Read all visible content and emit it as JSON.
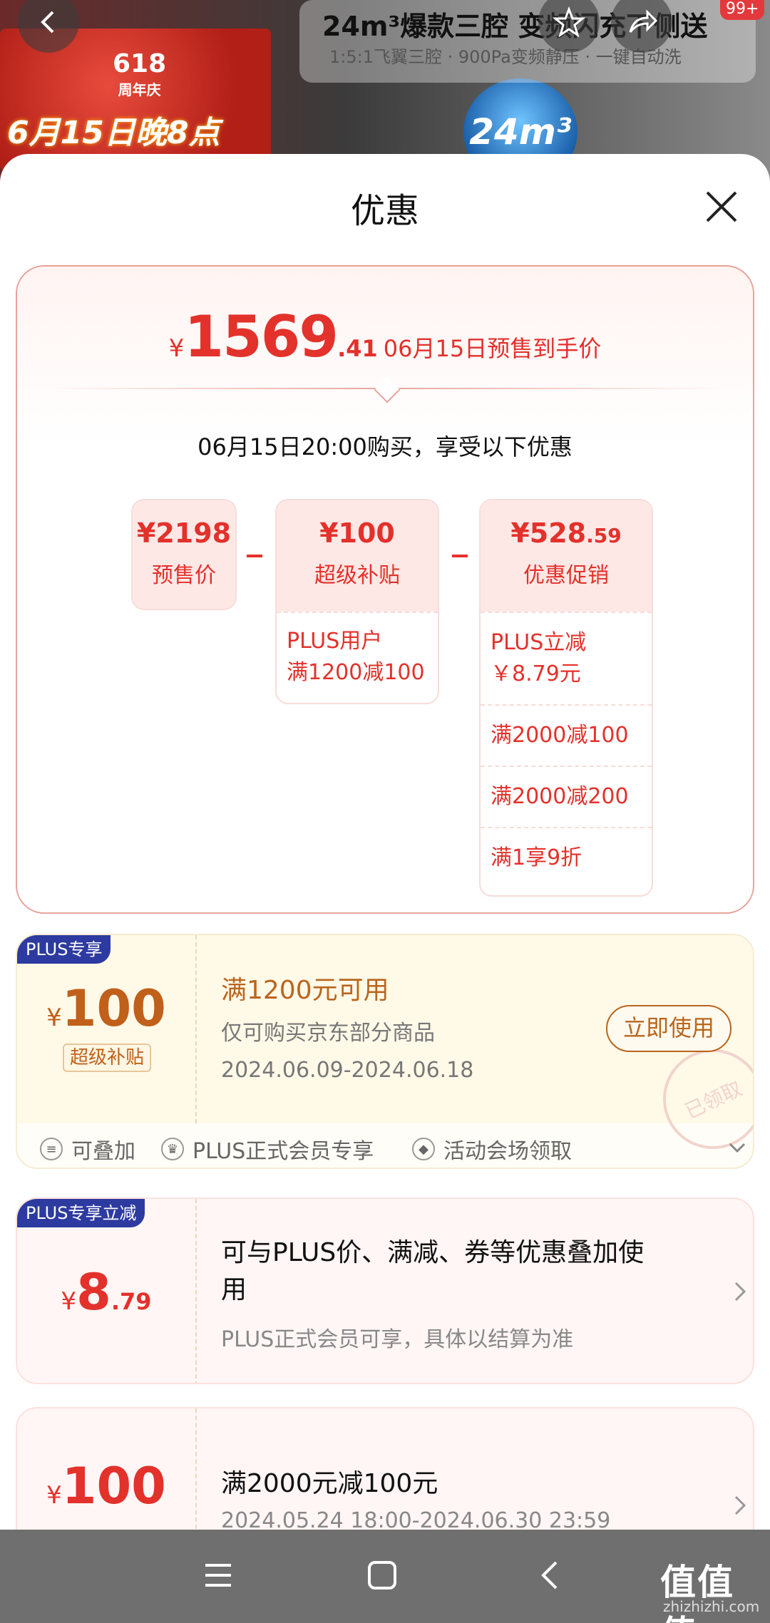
{
  "background": {
    "banner_618": "618",
    "banner_anniv": "周年庆",
    "banner_date": "6月15日晚8点",
    "product_title": "24m³爆款三腔 变频闪充下侧送",
    "product_subtitle": "1:5:1飞翼三腔 · 900Pa变频静压 · 一键自动洗",
    "product_badge": "24m³",
    "cart_badge": "99+"
  },
  "sheet": {
    "title": "优惠"
  },
  "price_summary": {
    "currency": "¥",
    "int": "1569",
    "dec": ".41",
    "label": "06月15日预售到手价",
    "buy_note": "06月15日20:00购买，享受以下优惠",
    "presale": {
      "amount": "¥2198",
      "name": "预售价"
    },
    "subsidy": {
      "amount": "¥100",
      "name": "超级补贴",
      "items": [
        "PLUS用户\n满1200减100"
      ]
    },
    "promo": {
      "amount_int": "¥528",
      "amount_dec": ".59",
      "name": "优惠促销",
      "items": [
        "PLUS立减\n￥8.79元",
        "满2000减100",
        "满2000减200",
        "满1享9折"
      ]
    }
  },
  "coupons": [
    {
      "tag": "PLUS专享",
      "currency": "¥",
      "amount": "100",
      "chip": "超级补贴",
      "title": "满1200元可用",
      "desc": "仅可购买京东部分商品",
      "date": "2024.06.09-2024.06.18",
      "button": "立即使用",
      "stamp": "已领取",
      "features": [
        "可叠加",
        "PLUS正式会员专享",
        "活动会场领取"
      ]
    },
    {
      "tag": "PLUS专享立减",
      "currency": "¥",
      "amount_int": "8",
      "amount_dec": ".79",
      "title": "可与PLUS价、满减、券等优惠叠加使用",
      "desc": "PLUS正式会员可享，具体以结算为准"
    },
    {
      "currency": "¥",
      "amount": "100",
      "title": "满2000元减100元",
      "desc": "2024.05.24 18:00-2024.06.30 23:59"
    }
  ],
  "watermark": {
    "text": "值值值",
    "sub": "zhizhizhi.com"
  },
  "colors": {
    "accent": "#e3312b",
    "gold": "#b9661d",
    "plus_tag": "#2d3aa0"
  }
}
